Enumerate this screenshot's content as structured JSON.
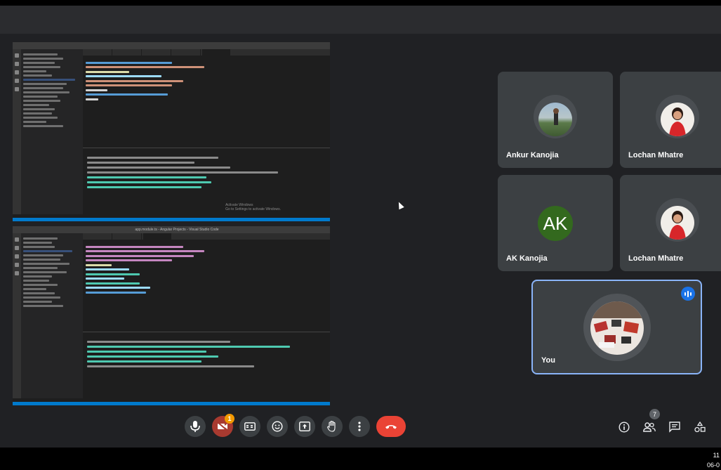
{
  "participants": [
    {
      "name": "Ankur Kanojia"
    },
    {
      "name": "Lochan Mhatre"
    },
    {
      "name": "AK Kanojia",
      "initials": "AK"
    },
    {
      "name": "Lochan Mhatre"
    },
    {
      "name": "You",
      "speaking": true
    }
  ],
  "shared_screen": {
    "top_window": {
      "watermark_line1": "Activate Windows",
      "watermark_line2": "Go to Settings to activate Windows."
    },
    "bottom_window": {
      "title": "app.module.ts - Angular Projects - Visual Studio Code"
    }
  },
  "controls": {
    "camera_badge": "1",
    "participant_count": "7"
  },
  "clock": {
    "time": "11",
    "date": "06-0"
  },
  "colors": {
    "accent_blue": "#1a73e8",
    "end_call_red": "#ea4335",
    "avatar_green": "#33691e",
    "badge_orange": "#f29900"
  }
}
